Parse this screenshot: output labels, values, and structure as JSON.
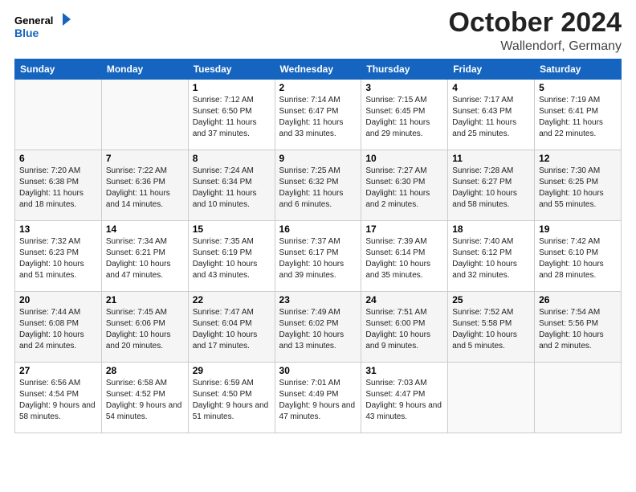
{
  "header": {
    "logo": {
      "line1": "General",
      "line2": "Blue"
    },
    "month": "October 2024",
    "location": "Wallendorf, Germany"
  },
  "weekdays": [
    "Sunday",
    "Monday",
    "Tuesday",
    "Wednesday",
    "Thursday",
    "Friday",
    "Saturday"
  ],
  "weeks": [
    [
      {
        "day": "",
        "info": ""
      },
      {
        "day": "",
        "info": ""
      },
      {
        "day": "1",
        "info": "Sunrise: 7:12 AM\nSunset: 6:50 PM\nDaylight: 11 hours and 37 minutes."
      },
      {
        "day": "2",
        "info": "Sunrise: 7:14 AM\nSunset: 6:47 PM\nDaylight: 11 hours and 33 minutes."
      },
      {
        "day": "3",
        "info": "Sunrise: 7:15 AM\nSunset: 6:45 PM\nDaylight: 11 hours and 29 minutes."
      },
      {
        "day": "4",
        "info": "Sunrise: 7:17 AM\nSunset: 6:43 PM\nDaylight: 11 hours and 25 minutes."
      },
      {
        "day": "5",
        "info": "Sunrise: 7:19 AM\nSunset: 6:41 PM\nDaylight: 11 hours and 22 minutes."
      }
    ],
    [
      {
        "day": "6",
        "info": "Sunrise: 7:20 AM\nSunset: 6:38 PM\nDaylight: 11 hours and 18 minutes."
      },
      {
        "day": "7",
        "info": "Sunrise: 7:22 AM\nSunset: 6:36 PM\nDaylight: 11 hours and 14 minutes."
      },
      {
        "day": "8",
        "info": "Sunrise: 7:24 AM\nSunset: 6:34 PM\nDaylight: 11 hours and 10 minutes."
      },
      {
        "day": "9",
        "info": "Sunrise: 7:25 AM\nSunset: 6:32 PM\nDaylight: 11 hours and 6 minutes."
      },
      {
        "day": "10",
        "info": "Sunrise: 7:27 AM\nSunset: 6:30 PM\nDaylight: 11 hours and 2 minutes."
      },
      {
        "day": "11",
        "info": "Sunrise: 7:28 AM\nSunset: 6:27 PM\nDaylight: 10 hours and 58 minutes."
      },
      {
        "day": "12",
        "info": "Sunrise: 7:30 AM\nSunset: 6:25 PM\nDaylight: 10 hours and 55 minutes."
      }
    ],
    [
      {
        "day": "13",
        "info": "Sunrise: 7:32 AM\nSunset: 6:23 PM\nDaylight: 10 hours and 51 minutes."
      },
      {
        "day": "14",
        "info": "Sunrise: 7:34 AM\nSunset: 6:21 PM\nDaylight: 10 hours and 47 minutes."
      },
      {
        "day": "15",
        "info": "Sunrise: 7:35 AM\nSunset: 6:19 PM\nDaylight: 10 hours and 43 minutes."
      },
      {
        "day": "16",
        "info": "Sunrise: 7:37 AM\nSunset: 6:17 PM\nDaylight: 10 hours and 39 minutes."
      },
      {
        "day": "17",
        "info": "Sunrise: 7:39 AM\nSunset: 6:14 PM\nDaylight: 10 hours and 35 minutes."
      },
      {
        "day": "18",
        "info": "Sunrise: 7:40 AM\nSunset: 6:12 PM\nDaylight: 10 hours and 32 minutes."
      },
      {
        "day": "19",
        "info": "Sunrise: 7:42 AM\nSunset: 6:10 PM\nDaylight: 10 hours and 28 minutes."
      }
    ],
    [
      {
        "day": "20",
        "info": "Sunrise: 7:44 AM\nSunset: 6:08 PM\nDaylight: 10 hours and 24 minutes."
      },
      {
        "day": "21",
        "info": "Sunrise: 7:45 AM\nSunset: 6:06 PM\nDaylight: 10 hours and 20 minutes."
      },
      {
        "day": "22",
        "info": "Sunrise: 7:47 AM\nSunset: 6:04 PM\nDaylight: 10 hours and 17 minutes."
      },
      {
        "day": "23",
        "info": "Sunrise: 7:49 AM\nSunset: 6:02 PM\nDaylight: 10 hours and 13 minutes."
      },
      {
        "day": "24",
        "info": "Sunrise: 7:51 AM\nSunset: 6:00 PM\nDaylight: 10 hours and 9 minutes."
      },
      {
        "day": "25",
        "info": "Sunrise: 7:52 AM\nSunset: 5:58 PM\nDaylight: 10 hours and 5 minutes."
      },
      {
        "day": "26",
        "info": "Sunrise: 7:54 AM\nSunset: 5:56 PM\nDaylight: 10 hours and 2 minutes."
      }
    ],
    [
      {
        "day": "27",
        "info": "Sunrise: 6:56 AM\nSunset: 4:54 PM\nDaylight: 9 hours and 58 minutes."
      },
      {
        "day": "28",
        "info": "Sunrise: 6:58 AM\nSunset: 4:52 PM\nDaylight: 9 hours and 54 minutes."
      },
      {
        "day": "29",
        "info": "Sunrise: 6:59 AM\nSunset: 4:50 PM\nDaylight: 9 hours and 51 minutes."
      },
      {
        "day": "30",
        "info": "Sunrise: 7:01 AM\nSunset: 4:49 PM\nDaylight: 9 hours and 47 minutes."
      },
      {
        "day": "31",
        "info": "Sunrise: 7:03 AM\nSunset: 4:47 PM\nDaylight: 9 hours and 43 minutes."
      },
      {
        "day": "",
        "info": ""
      },
      {
        "day": "",
        "info": ""
      }
    ]
  ]
}
